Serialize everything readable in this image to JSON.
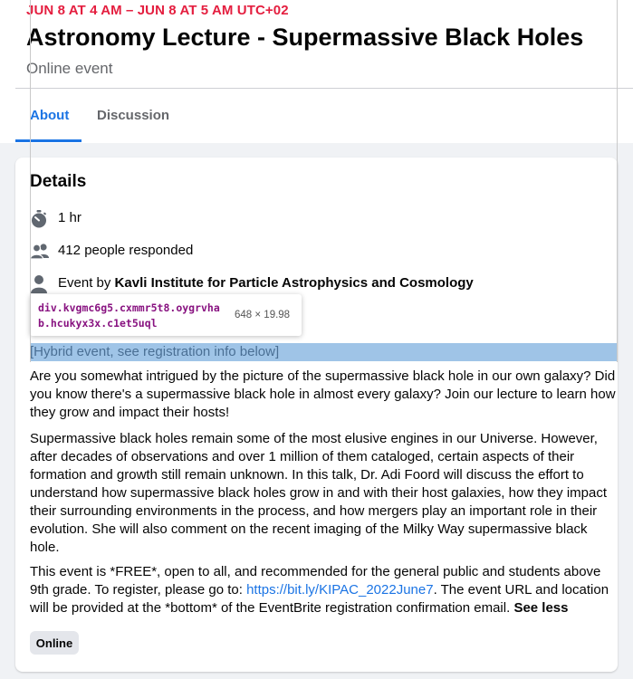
{
  "event": {
    "date": "JUN 8 AT 4 AM – JUN 8 AT 5 AM UTC+02",
    "title": "Astronomy Lecture - Supermassive Black Holes",
    "type": "Online event"
  },
  "tabs": [
    {
      "label": "About",
      "active": true
    },
    {
      "label": "Discussion",
      "active": false
    }
  ],
  "details": {
    "heading": "Details",
    "duration": "1 hr",
    "responded": "412 people responded",
    "event_by_prefix": "Event by",
    "organizer": "Kavli Institute for Particle Astrophysics and Cosmology"
  },
  "devtools_tooltip": {
    "selector": "div.kvgmc6g5.cxmmr5t8.oygrvhab.hcukyx3x.c1et5uql",
    "dimensions": "648 × 19.98"
  },
  "description": {
    "hybrid_line": "[Hybrid event, see registration info below]",
    "para1": "Are you somewhat intrigued by the picture of the supermassive black hole in our own galaxy? Did you know there's a supermassive black hole in almost every galaxy? Join our lecture to learn how they grow and impact their hosts!",
    "para2": "Supermassive black holes remain some of the most elusive engines in our Universe. However, after decades of observations and over 1 million of them cataloged, certain aspects of their formation and growth still remain unknown. In this talk, Dr. Adi Foord will discuss the effort to understand how supermassive black holes grow in and with their host galaxies, how they impact their surrounding environments in the process, and how mergers play an important role in their evolution. She will also comment on the recent imaging of the Milky Way supermassive black hole.",
    "para3_before": "This event is *FREE*, open to all, and recommended for the general public and students above 9th grade. To register, please go to: ",
    "para3_link": "https://bit.ly/KIPAC_2022June7",
    "para3_after": ". The event URL and location will be provided at the *bottom* of the EventBrite registration confirmation email. ",
    "see_less": "See less"
  },
  "chip": "Online",
  "icons": {
    "duration": "stopwatch-icon",
    "responded": "people-icon",
    "organizer": "person-icon"
  },
  "colors": {
    "date": "#e41e3f",
    "accent": "#1b74e4",
    "highlight": "#9fc4e7",
    "selector": "#881280"
  }
}
